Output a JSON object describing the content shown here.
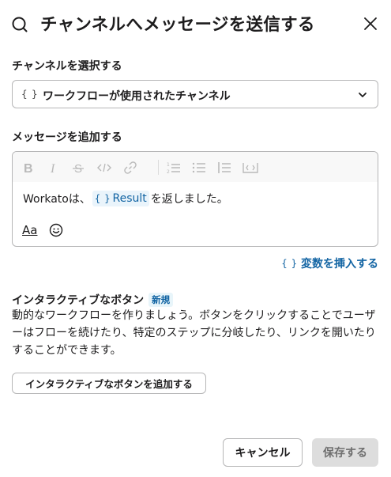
{
  "dialog": {
    "title": "チャンネルへメッセージを送信する",
    "title_icon": "search-icon",
    "close_icon": "close-icon"
  },
  "channel": {
    "label": "チャンネルを選択する",
    "value_icon": "{ }",
    "value": "ワークフローが使用されたチャンネル"
  },
  "message": {
    "label": "メッセージを追加する",
    "toolbar": [
      "bold-icon",
      "italic-icon",
      "strikethrough-icon",
      "code-icon",
      "link-icon",
      "numbered-list-icon",
      "bulleted-list-icon",
      "indent-icon",
      "code-block-icon"
    ],
    "text_before": "Workatoは、",
    "pill_icon": "{ }",
    "pill_label": "Result",
    "text_after": "を返しました。",
    "format_label": "Aa"
  },
  "insert_variable": {
    "icon": "{ }",
    "label": "変数を挿入する"
  },
  "interactive": {
    "title": "インタラクティブなボタン",
    "badge": "新規",
    "description": "動的なワークフローを作りましょう。ボタンをクリックすることでユーザーはフローを続けたり、特定のステップに分岐したり、リンクを開いたりすることができます。",
    "add_button": "インタラクティブなボタンを追加する"
  },
  "footer": {
    "cancel": "キャンセル",
    "save": "保存する"
  },
  "colors": {
    "accent": "#1264a3",
    "border": "#b6b6b7",
    "disabled_bg": "#dddddd"
  }
}
